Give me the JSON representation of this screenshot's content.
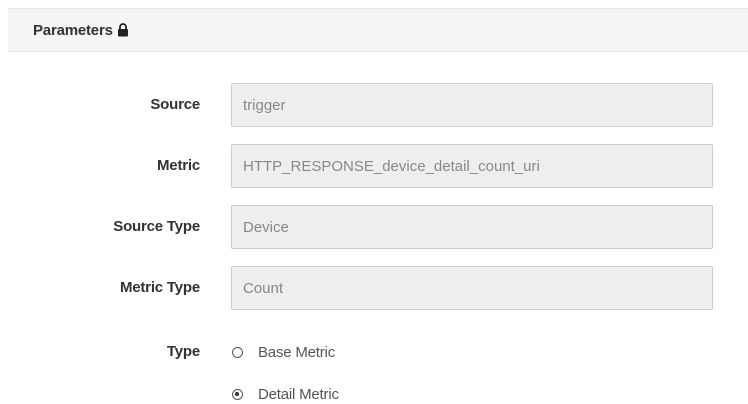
{
  "header": {
    "title": "Parameters",
    "icon": "lock-icon"
  },
  "fields": {
    "source": {
      "label": "Source",
      "value": "trigger"
    },
    "metric": {
      "label": "Metric",
      "value": "HTTP_RESPONSE_device_detail_count_uri"
    },
    "source_type": {
      "label": "Source Type",
      "value": "Device"
    },
    "metric_type": {
      "label": "Metric Type",
      "value": "Count"
    }
  },
  "type": {
    "label": "Type",
    "options": [
      {
        "label": "Base Metric",
        "checked": false
      },
      {
        "label": "Detail Metric",
        "checked": true
      }
    ]
  }
}
